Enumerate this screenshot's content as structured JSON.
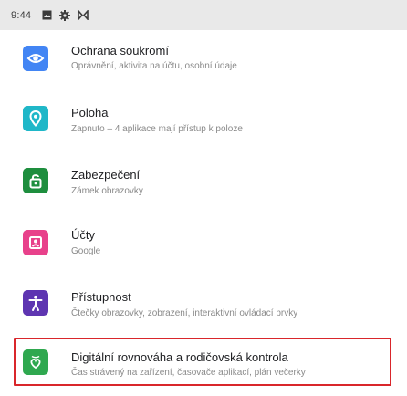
{
  "status_bar": {
    "time": "9:44",
    "icons": [
      "image-icon",
      "gear-icon",
      "cast-icon"
    ]
  },
  "settings": [
    {
      "title": "Ochrana soukromí",
      "subtitle": "Oprávnění, aktivita na účtu, osobní údaje",
      "icon": "privacy-eye-icon",
      "color": "#4285f4"
    },
    {
      "title": "Poloha",
      "subtitle": "Zapnuto – 4 aplikace mají přístup k poloze",
      "icon": "location-pin-icon",
      "color": "#1fb7c8"
    },
    {
      "title": "Zabezpečení",
      "subtitle": "Zámek obrazovky",
      "icon": "lock-icon",
      "color": "#1e8e3e"
    },
    {
      "title": "Účty",
      "subtitle": "Google",
      "icon": "account-icon",
      "color": "#e8418b"
    },
    {
      "title": "Přístupnost",
      "subtitle": "Čtečky obrazovky, zobrazení, interaktivní ovládací prvky",
      "icon": "accessibility-icon",
      "color": "#5e35b1"
    },
    {
      "title": "Digitální rovnováha a rodičovská kontrola",
      "subtitle": "Čas strávený na zařízení, časovače aplikací, plán večerky",
      "icon": "digital-wellbeing-icon",
      "color": "#2fa84f"
    }
  ],
  "highlight_color": "#d9262b"
}
